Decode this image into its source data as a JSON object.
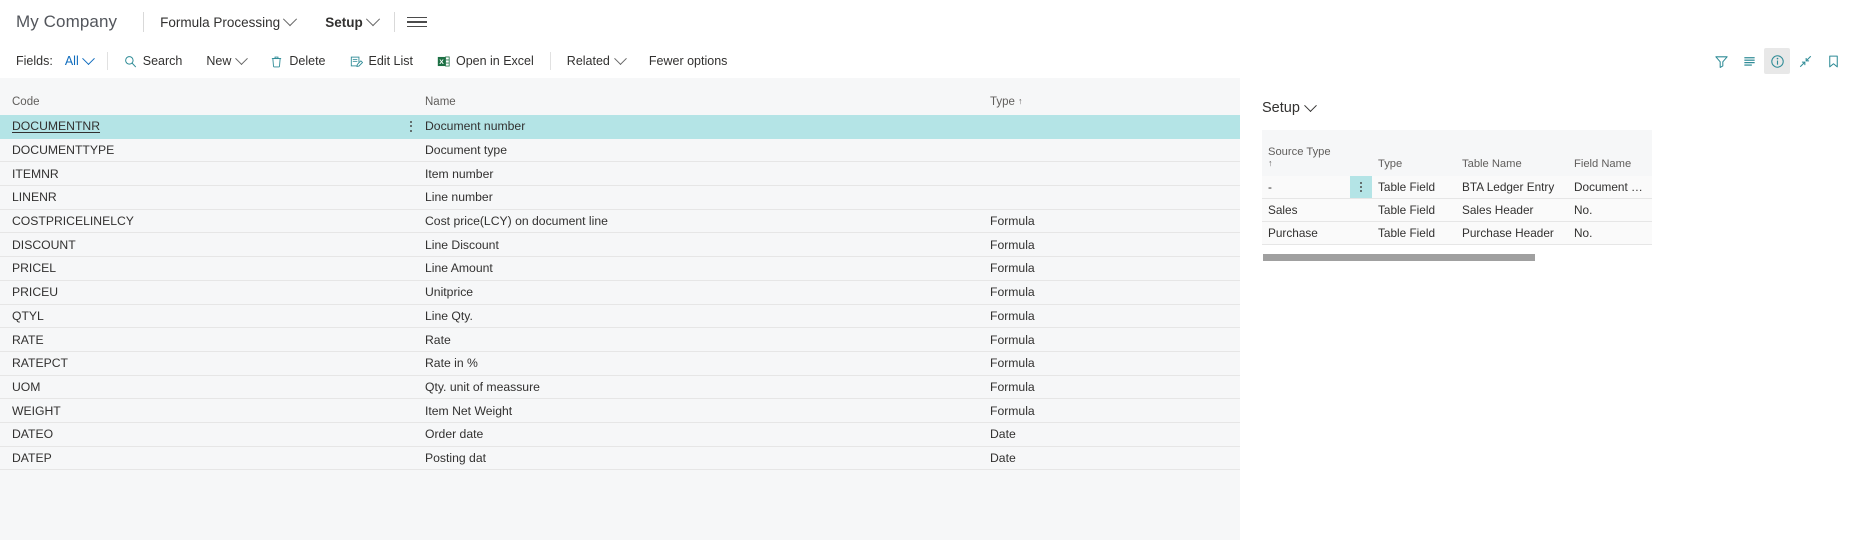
{
  "topnav": {
    "company": "My Company",
    "items": [
      {
        "label": "Formula Processing",
        "current": false
      },
      {
        "label": "Setup",
        "current": true
      }
    ],
    "menu_icon": "hamburger-icon"
  },
  "actionbar": {
    "fields_label": "Fields:",
    "fields_value": "All",
    "actions": [
      {
        "label": "Search",
        "icon": "search-icon"
      },
      {
        "label": "New",
        "icon": "chevron-down-icon"
      },
      {
        "label": "Delete",
        "icon": "trash-icon"
      },
      {
        "label": "Edit List",
        "icon": "edit-list-icon"
      },
      {
        "label": "Open in Excel",
        "icon": "excel-icon"
      },
      {
        "label": "Related",
        "icon": "chevron-down-icon"
      },
      {
        "label": "Fewer options",
        "icon": "none"
      }
    ],
    "right_icons": [
      {
        "name": "filter-icon",
        "active": false
      },
      {
        "name": "list-view-icon",
        "active": false
      },
      {
        "name": "info-icon",
        "active": true
      },
      {
        "name": "collapse-icon",
        "active": false
      },
      {
        "name": "bookmark-icon",
        "active": false
      }
    ]
  },
  "grid": {
    "columns": [
      "Code",
      "Name",
      "Type"
    ],
    "sort_column": "Type",
    "sort_direction": "ascending",
    "rows": [
      {
        "code": "DOCUMENTNR",
        "name": "Document number",
        "type": "",
        "selected": true
      },
      {
        "code": "DOCUMENTTYPE",
        "name": "Document type",
        "type": "",
        "selected": false
      },
      {
        "code": "ITEMNR",
        "name": "Item number",
        "type": "",
        "selected": false
      },
      {
        "code": "LINENR",
        "name": "Line number",
        "type": "",
        "selected": false
      },
      {
        "code": "COSTPRICELINELCY",
        "name": "Cost price(LCY) on document line",
        "type": "Formula",
        "selected": false
      },
      {
        "code": "DISCOUNT",
        "name": "Line Discount",
        "type": "Formula",
        "selected": false
      },
      {
        "code": "PRICEL",
        "name": "Line Amount",
        "type": "Formula",
        "selected": false
      },
      {
        "code": "PRICEU",
        "name": "Unitprice",
        "type": "Formula",
        "selected": false
      },
      {
        "code": "QTYL",
        "name": "Line Qty.",
        "type": "Formula",
        "selected": false
      },
      {
        "code": "RATE",
        "name": "Rate",
        "type": "Formula",
        "selected": false
      },
      {
        "code": "RATEPCT",
        "name": "Rate in %",
        "type": "Formula",
        "selected": false
      },
      {
        "code": "UOM",
        "name": "Qty. unit of meassure",
        "type": "Formula",
        "selected": false
      },
      {
        "code": "WEIGHT",
        "name": "Item Net Weight",
        "type": "Formula",
        "selected": false
      },
      {
        "code": "DATEO",
        "name": "Order date",
        "type": "Date",
        "selected": false
      },
      {
        "code": "DATEP",
        "name": "Posting dat",
        "type": "Date",
        "selected": false
      }
    ]
  },
  "side_panel": {
    "title": "Setup",
    "columns": [
      "Source Type",
      "Type",
      "Table Name",
      "Field Name"
    ],
    "sort_column": "Source Type",
    "sort_direction": "ascending",
    "rows": [
      {
        "source_type": "-",
        "type": "Table Field",
        "table_name": "BTA Ledger Entry",
        "field_name": "Document No",
        "selected": true
      },
      {
        "source_type": "Sales",
        "type": "Table Field",
        "table_name": "Sales Header",
        "field_name": "No.",
        "selected": false
      },
      {
        "source_type": "Purchase",
        "type": "Table Field",
        "table_name": "Purchase Header",
        "field_name": "No.",
        "selected": false
      }
    ]
  },
  "colors": {
    "selection": "#b4e4e6",
    "link": "#0f6cbd",
    "icon_teal": "#2e8b96",
    "page_bg": "#f6f7f8"
  }
}
